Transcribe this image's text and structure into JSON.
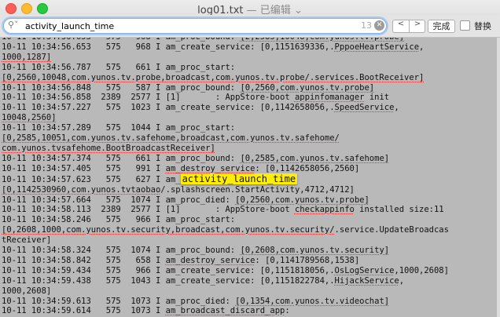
{
  "window": {
    "title": "log01.txt",
    "status": "— 已编辑",
    "chevron": "chevron-down-icon"
  },
  "find": {
    "query": "activity_launch_time",
    "count": "13",
    "prev_label": "<",
    "next_label": ">",
    "done_label": "完成",
    "replace_label": "替换",
    "replace_checked": false
  },
  "log": {
    "highlight": "activity_launch_time",
    "lines": [
      [
        {
          "t": "10-11 10:34:56.653   575   968 I am_proc_bound: "
        },
        {
          "t": "[2,2585,10048,com.yunos.tv.probe]",
          "s": 1
        }
      ],
      [
        {
          "t": "10-11 10:34:56.653   575   968 I am_create_service: [0,1151639336,."
        },
        {
          "t": "PppoeHeartService",
          "s": 1
        },
        {
          "t": ","
        }
      ],
      [
        {
          "t": "1000,1287]",
          "s": 1
        }
      ],
      [
        {
          "t": "10-11 10:34:56.787   575   661 I am_proc_start:"
        }
      ],
      [
        {
          "t": "[0,2560,10048,com.yunos.tv.probe,broadcast,com.yunos.tv.probe/.services.BootReceiver]",
          "s": 1
        }
      ],
      [
        {
          "t": "10-11 10:34:56.848   575   587 I am_proc_bound: "
        },
        {
          "t": "[0,2560,com.yunos.tv.probe]",
          "s": 1
        }
      ],
      [
        {
          "t": "10-11 10:34:56.858  2389  2577 I [1]       : AppStore-boot "
        },
        {
          "t": "appinfomanager",
          "s": 1
        },
        {
          "t": " init"
        }
      ],
      [
        {
          "t": "10-11 10:34:57.227   575  1023 I am_create_service: [0,1142658056,."
        },
        {
          "t": "SpeedService",
          "s": 1
        },
        {
          "t": ","
        }
      ],
      [
        {
          "t": "10048,2560]",
          "s": 1
        }
      ],
      [
        {
          "t": "10-11 10:34:57.289   575  1044 I am_proc_start:"
        }
      ],
      [
        {
          "t": "[0,2585,10051,com.yunos.tv.safehome,broadcast,com.yunos.tv.safehome/",
          "s": 1
        }
      ],
      [
        {
          "t": "com.yunos.tvsafehome.BootBroadcastReceiver]",
          "s": 1
        }
      ],
      [
        {
          "t": "10-11 10:34:57.374   575   661 I am_proc_bound: "
        },
        {
          "t": "[0,2585,com.yunos.tv.safehome]",
          "s": 1
        }
      ],
      [
        {
          "t": "10-11 10:34:57.405   575   991 I "
        },
        {
          "t": "am_destroy_service",
          "s": 1
        },
        {
          "t": ": [0,1142658056,2560]"
        }
      ],
      [
        {
          "t": "10-11 10:34:57.623   575   627 I am_"
        },
        {
          "hl": 1
        }
      ],
      [
        {
          "t": "[0,1142530960,com.yunos.tvtaobao",
          "s": 1
        },
        {
          "t": "/.splashscreen.StartActivity,4712,4712]"
        }
      ],
      [
        {
          "t": "10-11 10:34:57.664   575  1074 I am_proc_died: "
        },
        {
          "t": "[0,2560,com.yunos.tv.probe]",
          "s": 1
        }
      ],
      [
        {
          "t": "10-11 10:34:58.113  2389  2577 I [1]       : AppStore-boot "
        },
        {
          "t": "checkappinfo",
          "s": 1
        },
        {
          "t": " installed size:11"
        }
      ],
      [
        {
          "t": "10-11 10:34:58.246   575   966 I am_proc_start:"
        }
      ],
      [
        {
          "t": "[0,2608,1000,com.yunos.tv.security,broadcast,com.yunos.tv.security/",
          "s": 1
        },
        {
          "t": ".service.UpdateBroadcas"
        }
      ],
      [
        {
          "t": "tReceiver]"
        }
      ],
      [
        {
          "t": "10-11 10:34:58.324   575  1074 I am_proc_bound: "
        },
        {
          "t": "[0,2608,com.yunos.tv.security]",
          "s": 1
        }
      ],
      [
        {
          "t": "10-11 10:34:58.842   575   658 I "
        },
        {
          "t": "am_destroy_service",
          "s": 1
        },
        {
          "t": ": [0,1141789568,1538]"
        }
      ],
      [
        {
          "t": "10-11 10:34:59.434   575   966 I am_create_service: [0,1151818056,."
        },
        {
          "t": "OsLogService",
          "s": 1
        },
        {
          "t": ",1000,2608]"
        }
      ],
      [
        {
          "t": "10-11 10:34:59.438   575  1043 I am_create_service: [0,1151822784,."
        },
        {
          "t": "HijackService",
          "s": 1
        },
        {
          "t": ","
        }
      ],
      [
        {
          "t": "1000,2608]"
        }
      ],
      [
        {
          "t": "10-11 10:34:59.613   575  1073 I am_proc_died: "
        },
        {
          "t": "[0,1354,com.yunos.tv.videochat]",
          "s": 1
        }
      ],
      [
        {
          "t": "10-11 10:34:59.614   575  1073 I "
        },
        {
          "t": "am_broadcast_discard_app",
          "s": 1
        },
        {
          "t": ":"
        }
      ]
    ]
  }
}
